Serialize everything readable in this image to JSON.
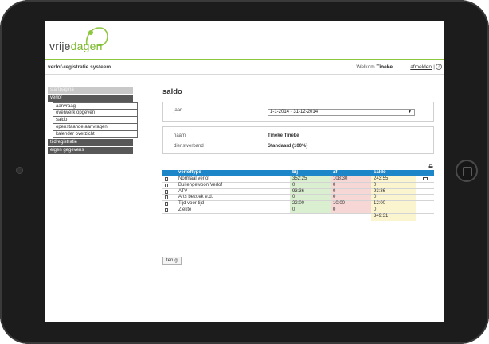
{
  "brand": {
    "logo_part1": "vrije",
    "logo_part2": "dagen",
    "accent": "#8dc63f"
  },
  "topbar": {
    "system_title": "verlof-registratie systeem",
    "welcome_prefix": "Welkom",
    "user_name": "Tineke",
    "logout_label": "afmelden",
    "separator": "|",
    "help_icon": "help-icon"
  },
  "sidebar": {
    "startpagina": "startpagina",
    "verlof": "verlof",
    "sub_items": [
      "aanvraag",
      "overwerk opgeven",
      "saldo",
      "openstaande aanvragen",
      "kalender overzicht"
    ],
    "tijdregistratie": "tijdregistratie",
    "eigen_gegevens": "eigen gegevens"
  },
  "main": {
    "title": "saldo",
    "year_label": "jaar",
    "year_value": "1-1-2014 - 31-12-2014",
    "name_label": "naam",
    "name_value": "Tineke Tineke",
    "employment_label": "dienstverband",
    "employment_value": "Standaard (100%)",
    "back_label": "terug"
  },
  "table": {
    "headers": {
      "type": "verloftype",
      "bij": "bij",
      "af": "af",
      "saldo": "saldo"
    },
    "rows": [
      {
        "type": "Normaal verlof",
        "bij": "352:25",
        "af": "108:30",
        "saldo": "243:55"
      },
      {
        "type": "Buitengewoon Verlof",
        "bij": "0",
        "af": "0",
        "saldo": "0"
      },
      {
        "type": "ATV",
        "bij": "93:36",
        "af": "0",
        "saldo": "93:36"
      },
      {
        "type": "Arts bezoek e.d.",
        "bij": "0",
        "af": "0",
        "saldo": "0"
      },
      {
        "type": "Tijd voor tijd",
        "bij": "22:00",
        "af": "10:00",
        "saldo": "12:00"
      },
      {
        "type": "Ziekte",
        "bij": "0",
        "af": "0",
        "saldo": "0"
      }
    ],
    "total": "349:31"
  }
}
